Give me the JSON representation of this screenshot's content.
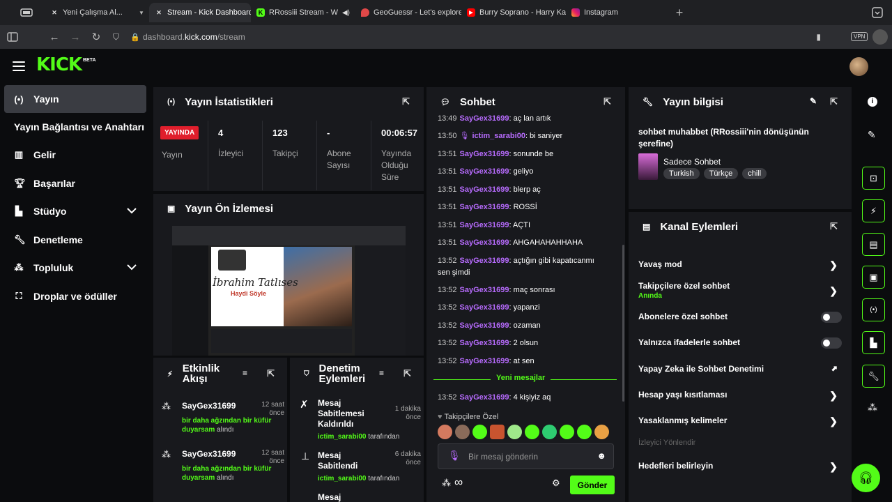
{
  "browser": {
    "tabs": [
      {
        "label": "Yeni Çalışma Al...",
        "active": false
      },
      {
        "label": "Stream - Kick Dashboard",
        "active": true
      },
      {
        "label": "RRossiii Stream - Watc",
        "active": false
      },
      {
        "label": "GeoGuessr - Let's explore",
        "active": false
      },
      {
        "label": "Burry Soprano - Harry Kan",
        "active": false
      },
      {
        "label": "Instagram",
        "active": false
      }
    ],
    "url_prefix": "dashboard.",
    "url_domain": "kick.com",
    "url_path": "/stream",
    "vpn_label": "VPN"
  },
  "app": {
    "logo": "KICK",
    "logo_badge": "BETA"
  },
  "sidebar": {
    "items": [
      {
        "label": "Yayın",
        "icon": "broadcast-icon",
        "active": true
      },
      {
        "label": "Yayın Bağlantısı ve Anahtarı",
        "icon": "",
        "active": false
      },
      {
        "label": "Gelir",
        "icon": "chart-icon",
        "active": false
      },
      {
        "label": "Başarılar",
        "icon": "trophy-icon",
        "active": false
      },
      {
        "label": "Stüdyo",
        "icon": "studio-icon",
        "active": false,
        "expandable": true
      },
      {
        "label": "Denetleme",
        "icon": "wrench-icon",
        "active": false
      },
      {
        "label": "Topluluk",
        "icon": "community-icon",
        "active": false,
        "expandable": true
      },
      {
        "label": "Droplar ve ödüller",
        "icon": "gift-icon",
        "active": false
      }
    ]
  },
  "stats": {
    "title": "Yayın İstatistikleri",
    "live_badge": "YAYINDA",
    "live_label": "Yayın",
    "cells": [
      {
        "value": "4",
        "label": "İzleyici"
      },
      {
        "value": "123",
        "label": "Takipçi"
      },
      {
        "value": "-",
        "label": "Abone Sayısı"
      },
      {
        "value": "00:06:57",
        "label": "Yayında Olduğu Süre"
      }
    ]
  },
  "preview": {
    "title": "Yayın Ön İzlemesi",
    "overlay_name": "İbrahim Tatlıses",
    "overlay_sub": "Haydi Söyle"
  },
  "activity": {
    "title": "Etkinlik Akışı",
    "items": [
      {
        "user": "SayGex31699",
        "time": "12 saat önce",
        "message": "bir daha ağzından bir küfür duyarsam",
        "suffix": "alındı"
      },
      {
        "user": "SayGex31699",
        "time": "12 saat önce",
        "message": "bir daha ağzından bir küfür duyarsam",
        "suffix": "alındı"
      }
    ]
  },
  "moderation": {
    "title": "Denetim Eylemleri",
    "items": [
      {
        "action": "Mesaj Sabitlemesi Kaldırıldı",
        "time": "1 dakika önce",
        "user": "ictim_sarabi00",
        "suffix": "tarafından"
      },
      {
        "action": "Mesaj Sabitlendi",
        "time": "6 dakika önce",
        "user": "ictim_sarabi00",
        "suffix": "tarafından"
      },
      {
        "action": "Mesaj",
        "time": "",
        "user": "",
        "suffix": ""
      }
    ]
  },
  "chat": {
    "title": "Sohbet",
    "messages": [
      {
        "time": "13:49",
        "user": "SayGex31699",
        "text": ": aç lan artık",
        "color": "#b86cff"
      },
      {
        "time": "13:50",
        "user": "ictim_sarabi00",
        "text": ": bi saniyer",
        "color": "#b86cff"
      },
      {
        "time": "13:51",
        "user": "SayGex31699",
        "text": ": sonunde be",
        "color": "#b86cff"
      },
      {
        "time": "13:51",
        "user": "SayGex31699",
        "text": ": geliyo",
        "color": "#b86cff"
      },
      {
        "time": "13:51",
        "user": "SayGex31699",
        "text": ": blerp aç",
        "color": "#b86cff"
      },
      {
        "time": "13:51",
        "user": "SayGex31699",
        "text": ": ROSSİ",
        "color": "#b86cff"
      },
      {
        "time": "13:51",
        "user": "SayGex31699",
        "text": ": AÇTI",
        "color": "#b86cff"
      },
      {
        "time": "13:51",
        "user": "SayGex31699",
        "text": ": AHGAHAHAHHAHA",
        "color": "#b86cff"
      },
      {
        "time": "13:52",
        "user": "SayGex31699",
        "text": ": açtığın gibi kapatıcanmı sen şimdi",
        "color": "#b86cff"
      },
      {
        "time": "13:52",
        "user": "SayGex31699",
        "text": ": maç sonrası",
        "color": "#b86cff"
      },
      {
        "time": "13:52",
        "user": "SayGex31699",
        "text": ": yapanzi",
        "color": "#b86cff"
      },
      {
        "time": "13:52",
        "user": "SayGex31699",
        "text": ": ozaman",
        "color": "#b86cff"
      },
      {
        "time": "13:52",
        "user": "SayGex31699",
        "text": ": 2 olsun",
        "color": "#b86cff"
      },
      {
        "time": "13:52",
        "user": "SayGex31699",
        "text": ": at sen",
        "color": "#b86cff"
      }
    ],
    "new_messages_label": "Yeni mesajlar",
    "new_message": {
      "time": "13:52",
      "user": "SayGex31699",
      "text": ": 4 kişiyiz aq"
    },
    "follower_only_label": "Takipçilere Özel",
    "input_placeholder": "Bir mesaj gönderin",
    "send_label": "Gönder"
  },
  "stream_info": {
    "title": "Yayın bilgisi",
    "stream_title": "sohbet muhabbet (RRossiii'nin dönüşünün şerefine)",
    "category": "Sadece Sohbet",
    "tags": [
      "Turkish",
      "Türkçe",
      "chill"
    ]
  },
  "channel_actions": {
    "title": "Kanal Eylemleri",
    "items": [
      {
        "label": "Yavaş mod",
        "control": "chevron"
      },
      {
        "label": "Takipçilere özel sohbet",
        "sub": "Anında",
        "control": "chevron"
      },
      {
        "label": "Abonelere özel sohbet",
        "control": "toggle",
        "on": false
      },
      {
        "label": "Yalnızca ifadelerle sohbet",
        "control": "toggle",
        "on": false
      },
      {
        "label": "Yapay Zeka ile Sohbet Denetimi",
        "control": "external"
      },
      {
        "label": "Hesap yaşı kısıtlaması",
        "control": "chevron"
      },
      {
        "label": "Yasaklanmış kelimeler",
        "control": "chevron"
      }
    ],
    "section_label": "İzleyici Yönlendir",
    "goals_label": "Hedefleri belirleyin"
  },
  "colors": {
    "brand": "#53fc18",
    "panel": "#18191d",
    "background": "#0b0c0e",
    "live": "#e01e2c",
    "username": "#b86cff"
  }
}
